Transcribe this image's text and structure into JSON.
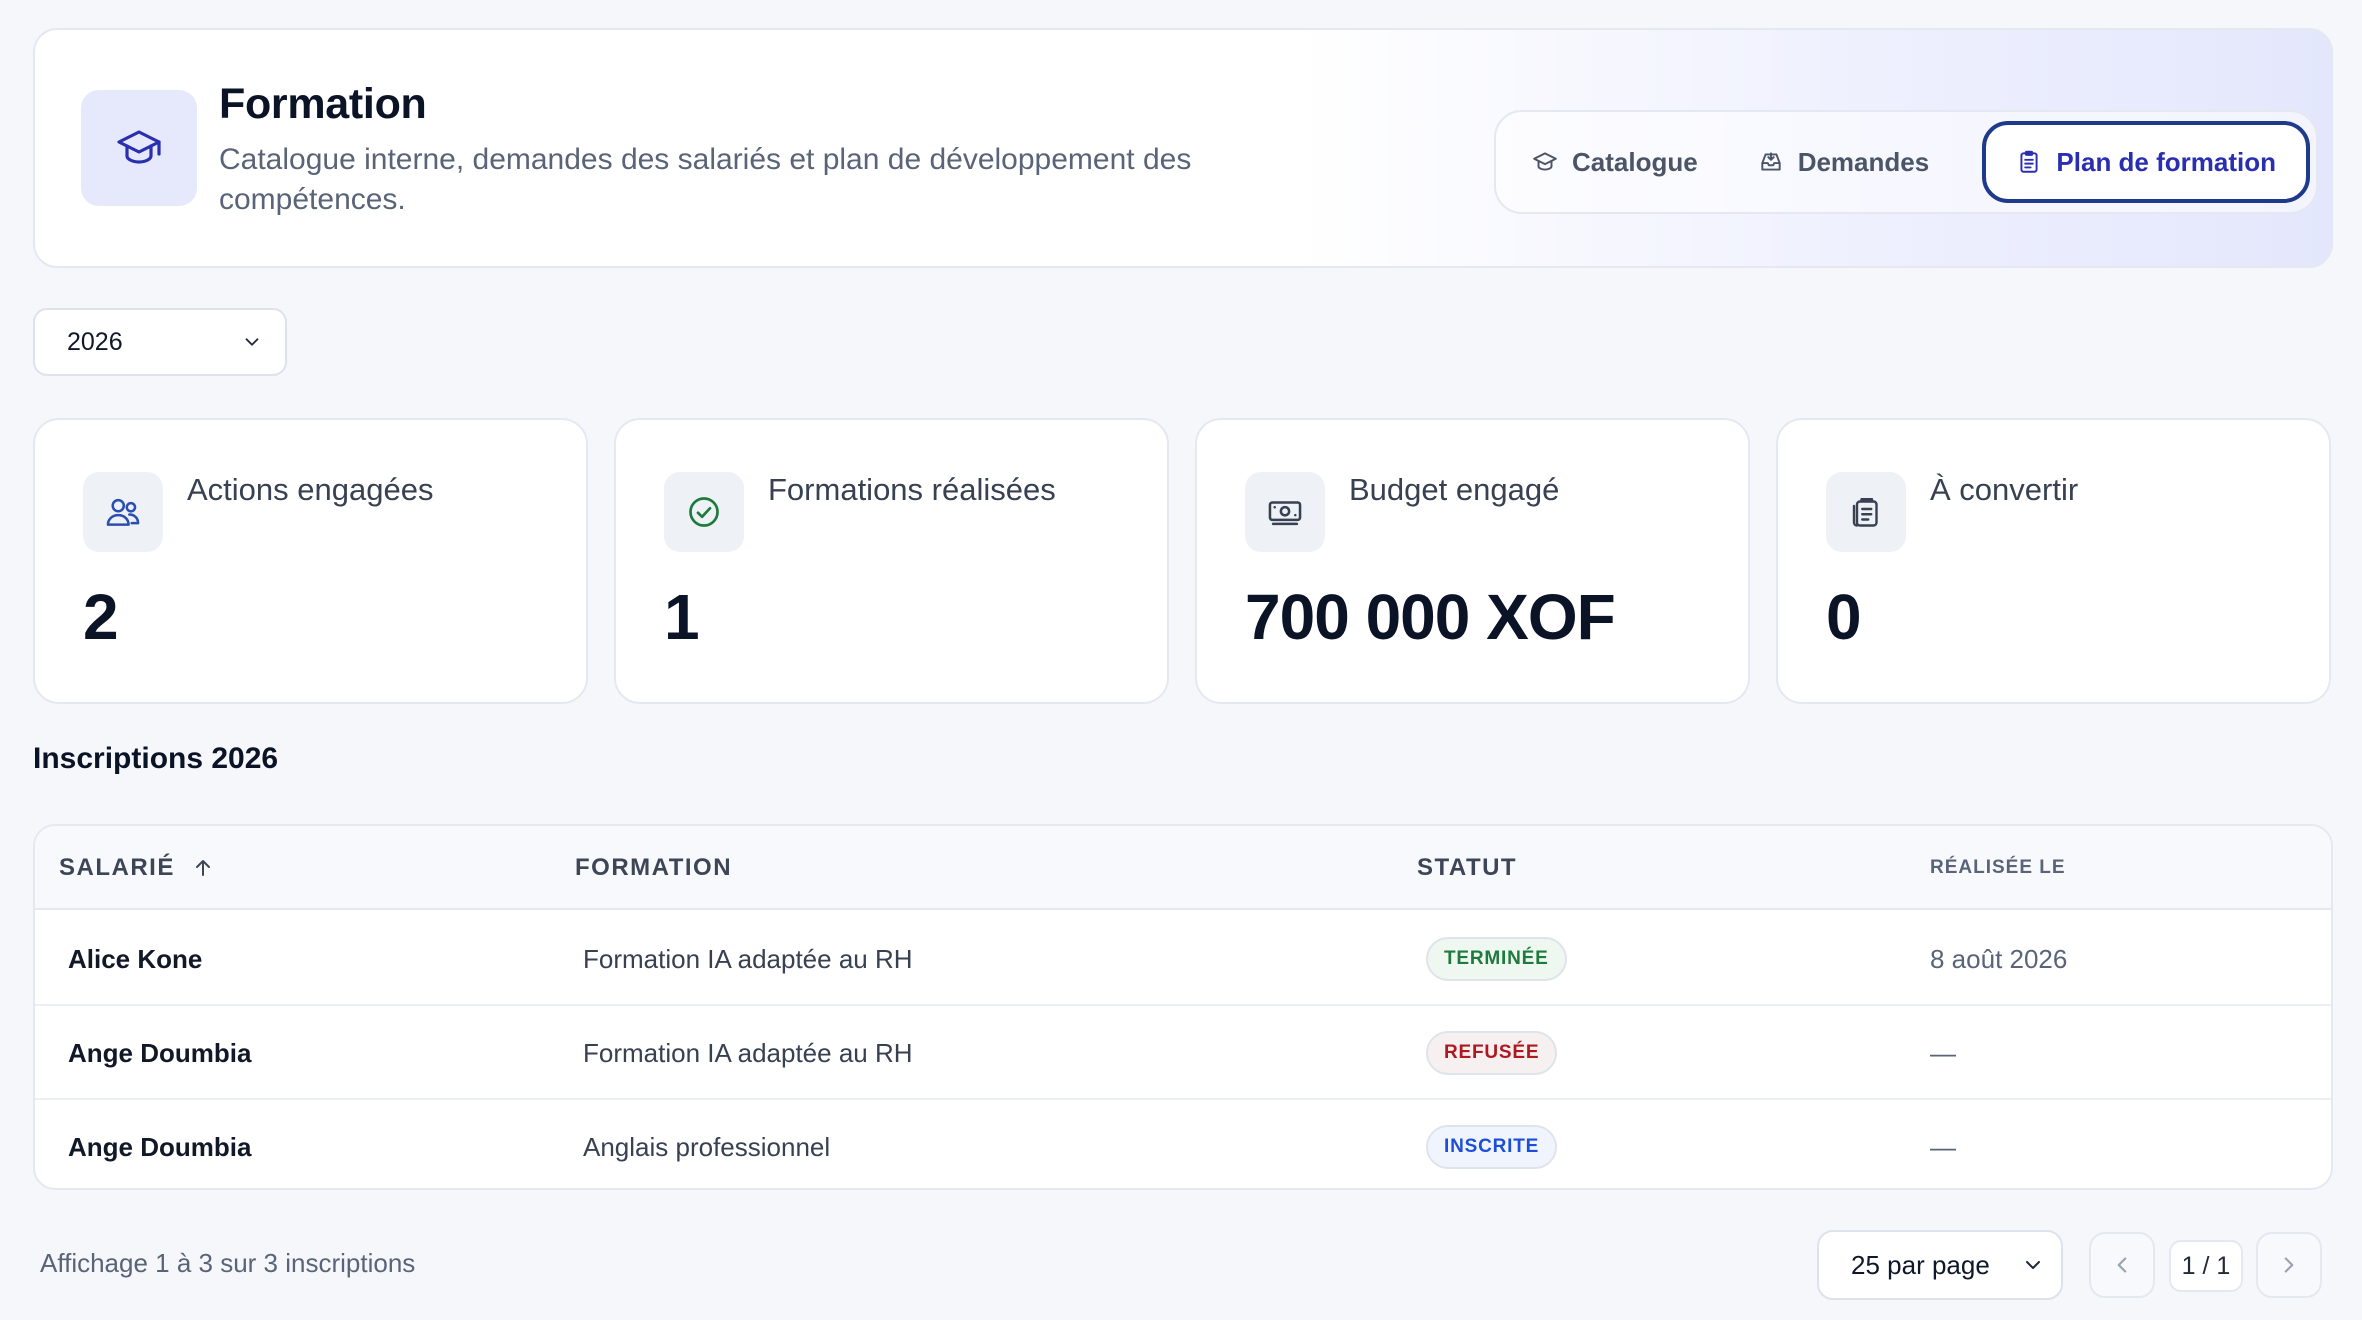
{
  "header": {
    "title": "Formation",
    "subtitle": "Catalogue interne, demandes des salariés et plan de développement des compétences.",
    "icon": "graduation-cap-icon",
    "tabs": [
      {
        "label": "Catalogue",
        "icon": "graduation-cap-icon",
        "active": false
      },
      {
        "label": "Demandes",
        "icon": "inbox-download-icon",
        "active": false
      },
      {
        "label": "Plan de formation",
        "icon": "clipboard-icon",
        "active": true
      }
    ]
  },
  "filters": {
    "year": "2026"
  },
  "stats": [
    {
      "label": "Actions engagées",
      "value": "2",
      "icon": "users-icon"
    },
    {
      "label": "Formations réalisées",
      "value": "1",
      "icon": "check-circle-icon"
    },
    {
      "label": "Budget engagé",
      "value": "700 000 XOF",
      "icon": "banknote-icon"
    },
    {
      "label": "À convertir",
      "value": "0",
      "icon": "clipboard-list-icon"
    }
  ],
  "section": {
    "title": "Inscriptions 2026"
  },
  "table": {
    "columns": [
      "SALARIÉ",
      "FORMATION",
      "STATUT",
      "RÉALISÉE LE"
    ],
    "rows": [
      {
        "employee": "Alice Kone",
        "formation": "Formation IA adaptée au RH",
        "status": "TERMINÉE",
        "date": "8 août 2026"
      },
      {
        "employee": "Ange Doumbia",
        "formation": "Formation IA adaptée au RH",
        "status": "REFUSÉE",
        "date": "—"
      },
      {
        "employee": "Ange Doumbia",
        "formation": "Anglais professionnel",
        "status": "INSCRITE",
        "date": "—"
      }
    ]
  },
  "footer": {
    "info": "Affichage 1 à 3 sur 3 inscriptions",
    "per_page": "25 par page",
    "page": "1 / 1"
  },
  "colors": {
    "accent": "#2a2fb0",
    "status_done": "#1f7a3d",
    "status_refused": "#b0171f",
    "status_enrolled": "#1d4ed8"
  }
}
